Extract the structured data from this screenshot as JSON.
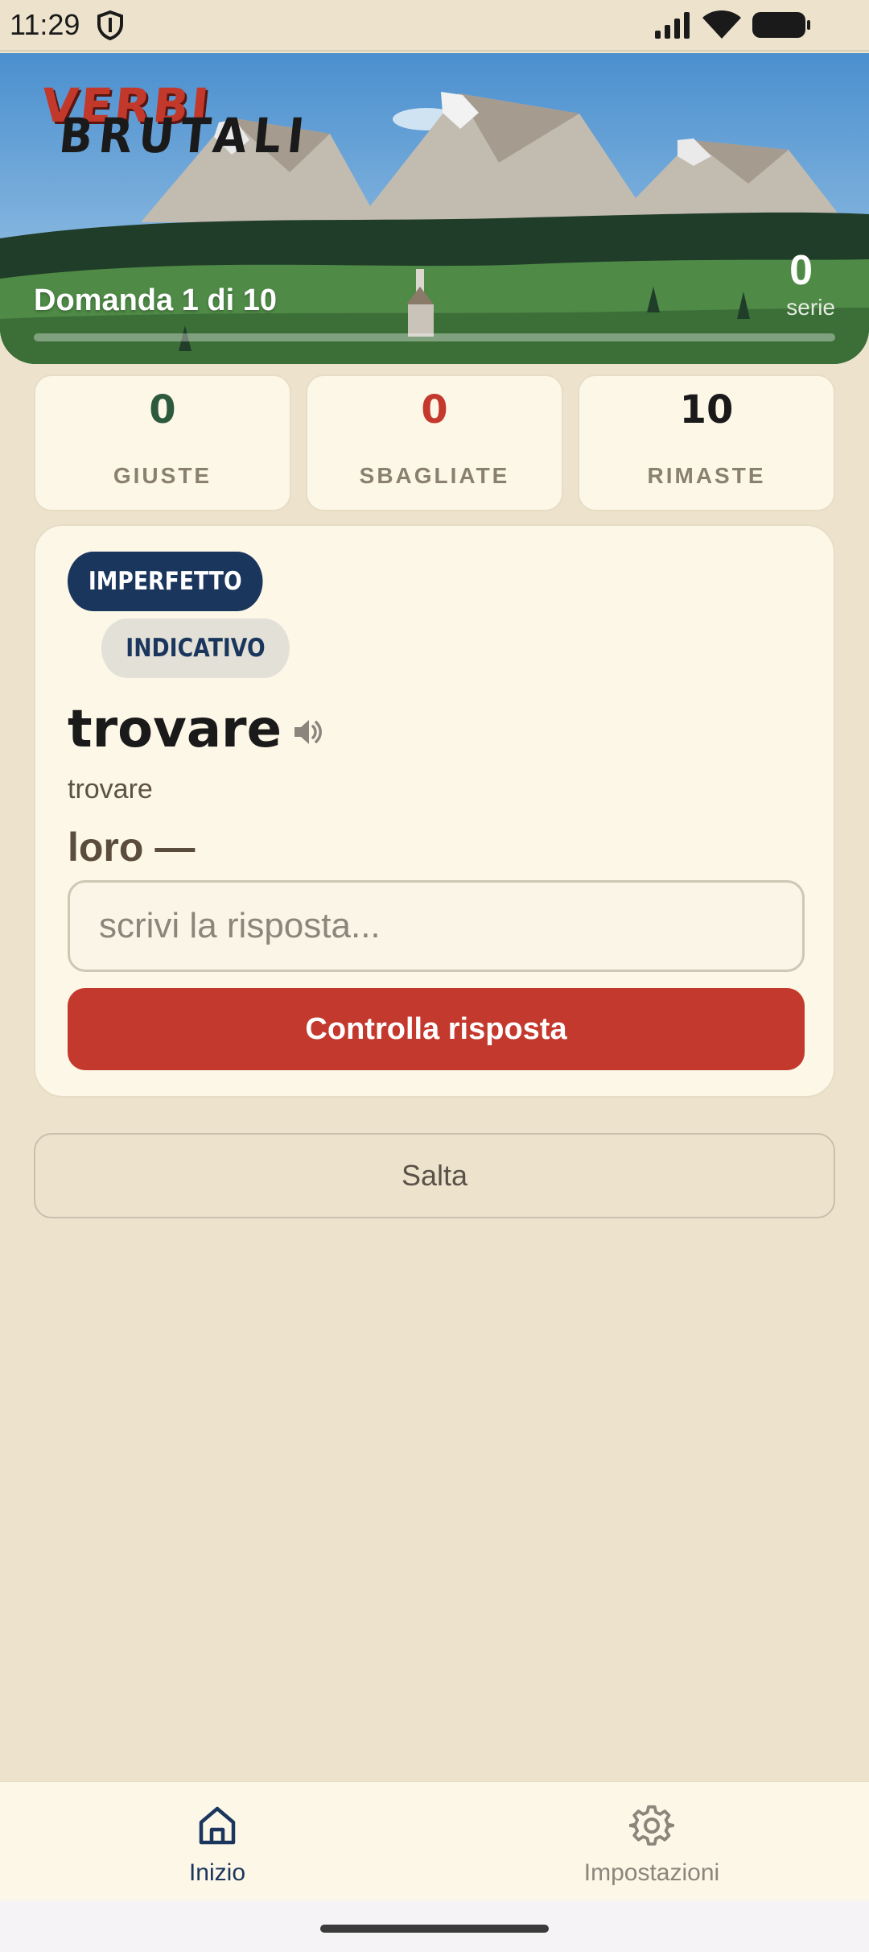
{
  "status_bar": {
    "time": "11:29",
    "icons": [
      "shield-icon",
      "signal-icon",
      "wifi-icon",
      "battery-icon"
    ]
  },
  "header": {
    "logo_top": "VERBI",
    "logo_bottom": "BRUTALI",
    "question_progress": "Domanda 1 di 10",
    "progress_fraction": 0.0,
    "streak_value": "0",
    "streak_label": "serie"
  },
  "stats": {
    "correct": {
      "value": "0",
      "label": "GIUSTE",
      "color": "#2d5a3d"
    },
    "wrong": {
      "value": "0",
      "label": "SBAGLIATE",
      "color": "#c4392d"
    },
    "remaining": {
      "value": "10",
      "label": "RIMASTE",
      "color": "#1a1a1a"
    }
  },
  "question": {
    "tense_tag": "IMPERFETTO",
    "mood_tag": "INDICATIVO",
    "verb": "trovare",
    "translation": "trovare",
    "subject": "loro —",
    "input_value": "",
    "input_placeholder": "scrivi la risposta...",
    "check_label": "Controlla risposta"
  },
  "skip_label": "Salta",
  "nav": {
    "home_label": "Inizio",
    "settings_label": "Impostazioni"
  },
  "colors": {
    "accent_red": "#c4392d",
    "navy": "#1b365d",
    "background": "#ede3cd",
    "card": "#fdf7e8"
  }
}
